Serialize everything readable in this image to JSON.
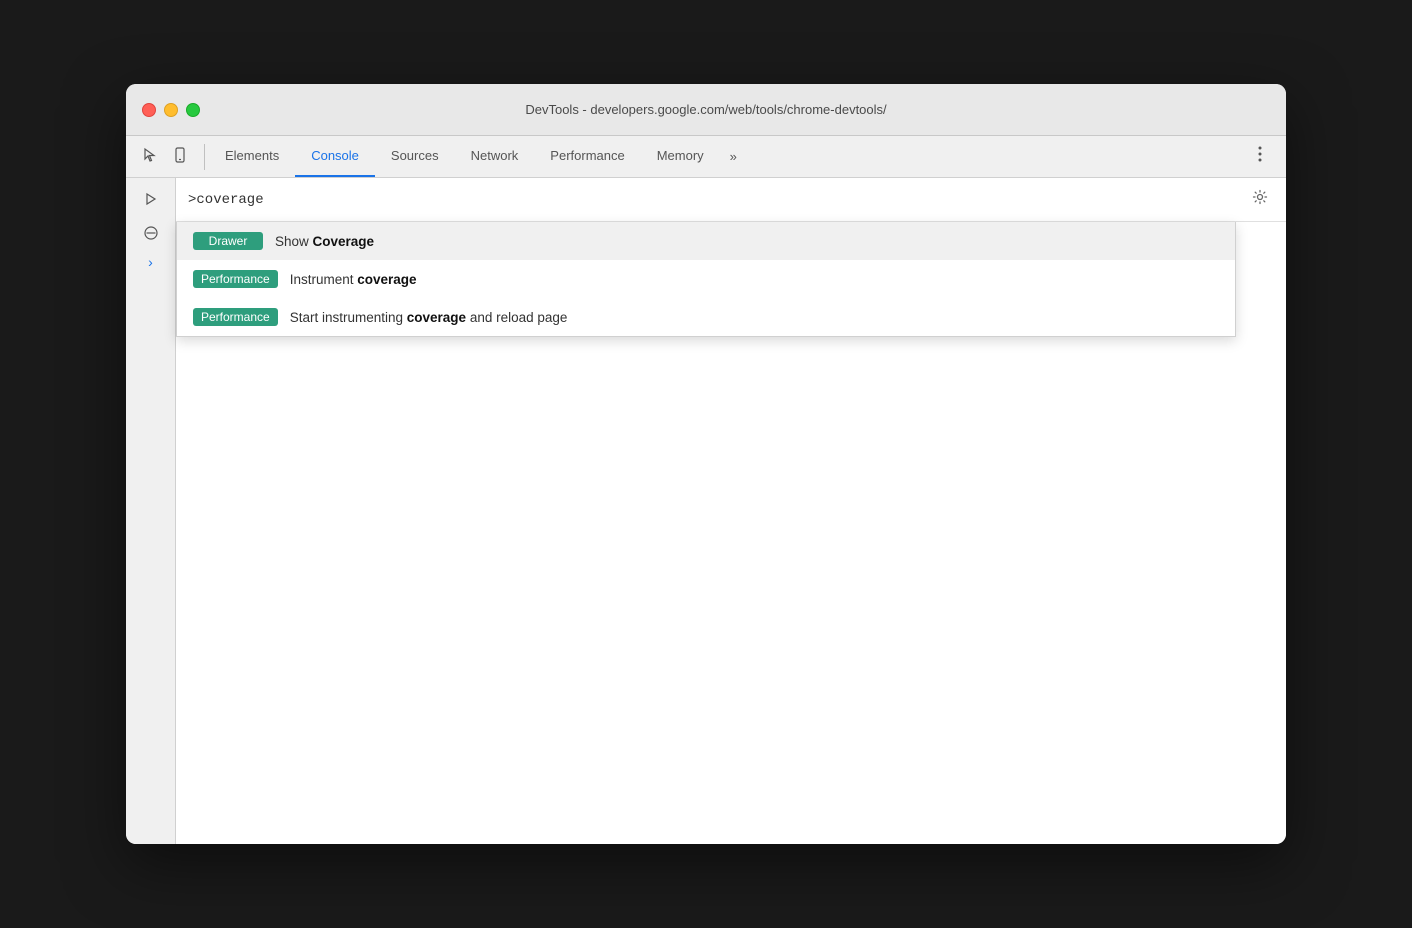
{
  "window": {
    "title": "DevTools - developers.google.com/web/tools/chrome-devtools/"
  },
  "traffic_lights": {
    "close_label": "close",
    "minimize_label": "minimize",
    "maximize_label": "maximize"
  },
  "tabs": [
    {
      "id": "elements",
      "label": "Elements",
      "active": false
    },
    {
      "id": "console",
      "label": "Console",
      "active": true
    },
    {
      "id": "sources",
      "label": "Sources",
      "active": false
    },
    {
      "id": "network",
      "label": "Network",
      "active": false
    },
    {
      "id": "performance",
      "label": "Performance",
      "active": false
    },
    {
      "id": "memory",
      "label": "Memory",
      "active": false
    }
  ],
  "tabs_more": "»",
  "console_input": ">coverage",
  "autocomplete": {
    "items": [
      {
        "tag": "Drawer",
        "tag_class": "tag-drawer",
        "prefix": "Show ",
        "bold": "Coverage",
        "suffix": ""
      },
      {
        "tag": "Performance",
        "tag_class": "tag-performance",
        "prefix": "Instrument ",
        "bold": "coverage",
        "suffix": ""
      },
      {
        "tag": "Performance",
        "tag_class": "tag-performance",
        "prefix": "Start instrumenting ",
        "bold": "coverage",
        "suffix": " and reload page"
      }
    ]
  },
  "icons": {
    "cursor": "⬚",
    "mobile": "⬜",
    "play": "▶",
    "clear": "🚫",
    "chevron_right": "›",
    "more_vertical": "⋮",
    "gear": "⚙"
  }
}
